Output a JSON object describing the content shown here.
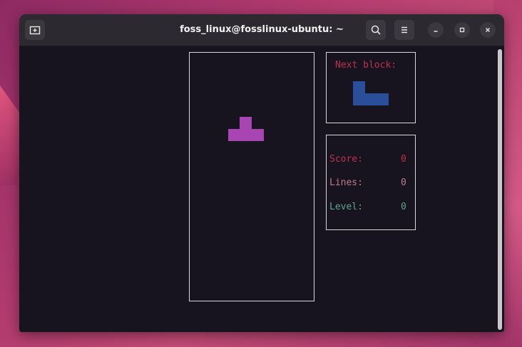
{
  "window": {
    "title": "foss_linux@fosslinux-ubuntu: ~"
  },
  "icons": {
    "new_tab": "new-tab-icon",
    "search": "search-icon",
    "menu": "hamburger-menu-icon",
    "minimize": "minimize-icon",
    "maximize": "maximize-icon",
    "close": "close-icon"
  },
  "game": {
    "current_piece": {
      "shape": "T",
      "color": "#a845b3"
    },
    "next_label": "Next block:",
    "next_piece": {
      "shape": "J",
      "color": "#2a4e9a"
    },
    "stats": [
      {
        "label": "Score:",
        "value": "0",
        "color": "#c0304f"
      },
      {
        "label": "Lines:",
        "value": "0",
        "color": "#c07a8a"
      },
      {
        "label": "Level:",
        "value": "0",
        "color": "#5aa88a"
      }
    ]
  }
}
